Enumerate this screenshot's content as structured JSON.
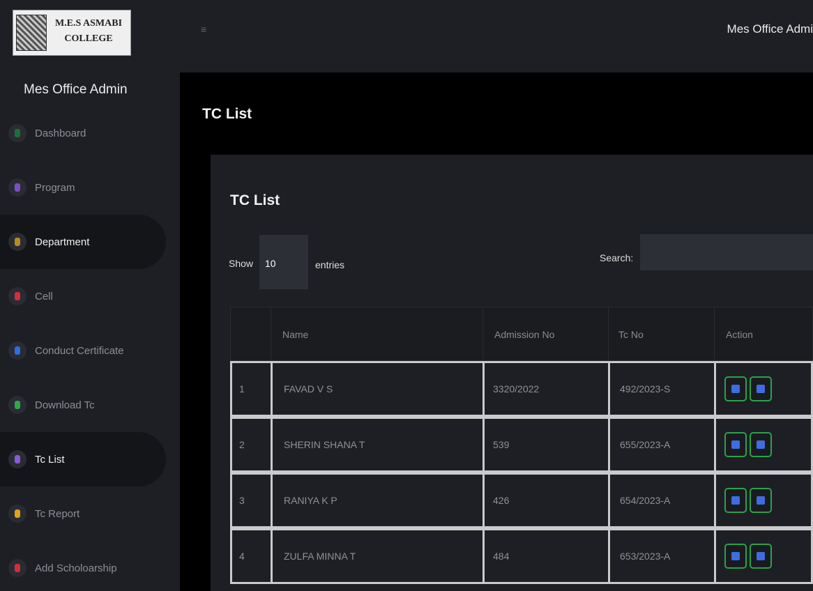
{
  "brand": {
    "logo_line1": "M.E.S ASMABI",
    "logo_line2": "COLLEGE",
    "admin_title": "Mes Office Admin"
  },
  "topbar": {
    "user": "Mes Office Admi",
    "menu_icon": "hamburger-icon"
  },
  "sidebar": {
    "items": [
      {
        "label": "Dashboard",
        "color": "#1f6f3a",
        "icon": "dashboard-icon",
        "active": false
      },
      {
        "label": "Program",
        "color": "#7a4fc4",
        "icon": "program-icon",
        "active": false
      },
      {
        "label": "Department",
        "color": "#b98a1f",
        "icon": "department-icon",
        "active": true
      },
      {
        "label": "Cell",
        "color": "#d0303a",
        "icon": "cell-icon",
        "active": false
      },
      {
        "label": "Conduct Certificate",
        "color": "#2f6ee0",
        "icon": "certificate-icon",
        "active": false
      },
      {
        "label": "Download Tc",
        "color": "#2ea84a",
        "icon": "download-icon",
        "active": false
      },
      {
        "label": "Tc List",
        "color": "#8a5ad6",
        "icon": "list-icon",
        "active": true
      },
      {
        "label": "Tc Report",
        "color": "#e0a21a",
        "icon": "report-icon",
        "active": false
      },
      {
        "label": "Add Scholoarship",
        "color": "#d0303a",
        "icon": "scholarship-icon",
        "active": false
      }
    ]
  },
  "main": {
    "page_title": "TC List",
    "card_title": "TC List",
    "show_label": "Show",
    "length_value": "10",
    "entries_label": "entries",
    "search_label": "Search:",
    "search_value": ""
  },
  "table": {
    "headers": [
      "",
      "Name",
      "Admission No",
      "Tc No",
      "Action"
    ],
    "rows": [
      {
        "no": "1",
        "name": "FAVAD V S",
        "admission": "3320/2022",
        "tc": "492/2023-S"
      },
      {
        "no": "2",
        "name": "SHERIN SHANA T",
        "admission": "539",
        "tc": "655/2023-A"
      },
      {
        "no": "3",
        "name": "RANIYA K P",
        "admission": "426",
        "tc": "654/2023-A"
      },
      {
        "no": "4",
        "name": "ZULFA MINNA T",
        "admission": "484",
        "tc": "653/2023-A"
      }
    ],
    "action_icons": [
      "edit-icon",
      "delete-icon"
    ]
  }
}
